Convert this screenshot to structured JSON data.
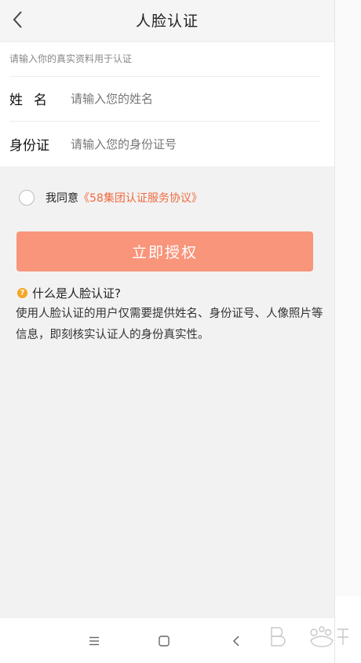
{
  "header": {
    "title": "人脸认证",
    "back_icon": "chevron-left-icon"
  },
  "form": {
    "hint": "请输入你的真实资料用于认证",
    "name": {
      "label": "姓名",
      "placeholder": "请输入您的姓名",
      "value": ""
    },
    "id_number": {
      "label": "身份证",
      "placeholder": "请输入您的身份证号",
      "value": ""
    }
  },
  "agreement": {
    "checked": false,
    "prefix": "我同意",
    "link": "《58集团认证服务协议》"
  },
  "authorize_button": {
    "label": "立即授权",
    "color": "#f8957b"
  },
  "faq": {
    "icon": "question-circle-icon",
    "question": "什么是人脸认证?",
    "answer": "使用人脸认证的用户仅需要提供姓名、身份证号、人像照片等信息，即刻核实认证人的身份真实性。"
  },
  "system_nav": {
    "menu_icon": "menu-icon",
    "home_icon": "home-square-icon",
    "back_icon": "back-triangle-icon"
  },
  "colors": {
    "accent": "#f06b3e",
    "button": "#f8957b",
    "faq_icon": "#f5a623",
    "background": "#f2f2f2"
  }
}
